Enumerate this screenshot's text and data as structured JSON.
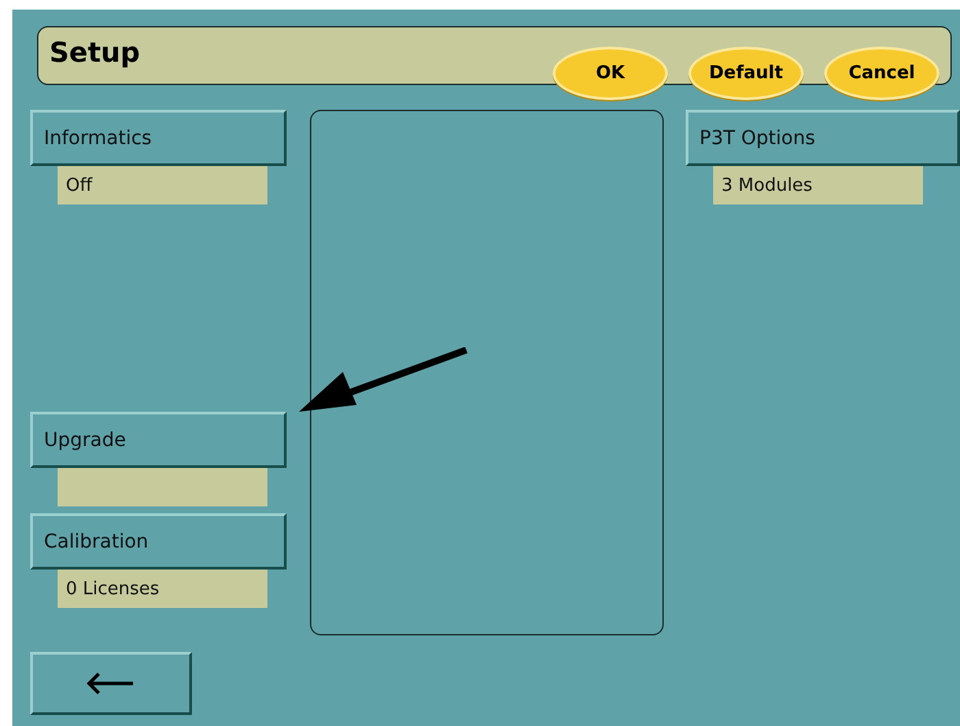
{
  "window": {
    "title": "Setup"
  },
  "header_buttons": [
    {
      "label": "OK"
    },
    {
      "label": "Default"
    },
    {
      "label": "Cancel"
    }
  ],
  "left_settings": [
    {
      "label": "Informatics",
      "value": "Off"
    },
    {
      "label": "Upgrade"
    },
    {
      "label": "Calibration",
      "value": "0 Licenses"
    }
  ],
  "right_settings": [
    {
      "label": "P3T Options",
      "value": "3 Modules"
    }
  ]
}
